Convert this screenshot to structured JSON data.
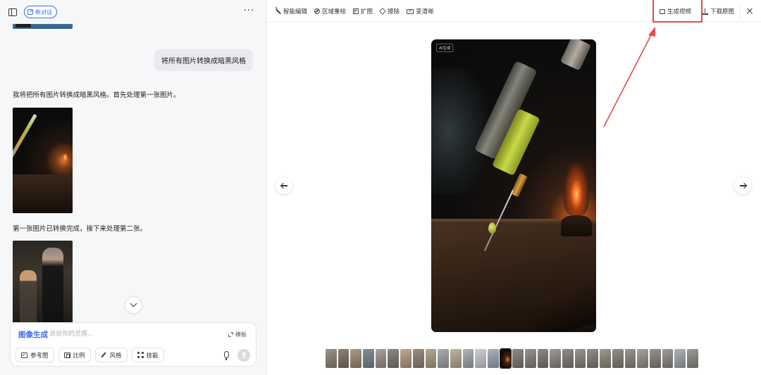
{
  "left_panel": {
    "new_chat_label": "新对话",
    "more_label": "···",
    "user_message": "将所有图片转换成暗黑风格",
    "assistant_message_1": "我将把所有图片转换成暗黑风格。首先处理第一张图片。",
    "assistant_message_2": "第一张图片已转换完成，接下来处理第二张。"
  },
  "composer": {
    "mode_label": "图像生成",
    "placeholder": "说说你的灵感...",
    "template_label": "模板",
    "tools": [
      {
        "label": "参考图",
        "icon": "image-icon"
      },
      {
        "label": "比例",
        "icon": "ratio-icon"
      },
      {
        "label": "风格",
        "icon": "brush-icon"
      },
      {
        "label": "技能",
        "icon": "grid-icon"
      }
    ],
    "mic_icon": "microphone-icon",
    "send_icon": "send-arrow-icon"
  },
  "toolbar": {
    "left_tools": [
      {
        "label": "智能编辑",
        "icon": "magic-wand-icon"
      },
      {
        "label": "区域重绘",
        "icon": "region-redraw-icon"
      },
      {
        "label": "扩图",
        "icon": "expand-image-icon"
      },
      {
        "label": "擦除",
        "icon": "eraser-icon"
      },
      {
        "label": "变清晰",
        "icon": "hd-icon"
      }
    ],
    "generate_video_label": "生成视频",
    "download_label": "下载原图",
    "close_icon": "close-icon"
  },
  "viewer": {
    "ai_badge": "AI生成",
    "prev_icon": "arrow-left-icon",
    "next_icon": "arrow-right-icon",
    "filmstrip_count": 30,
    "active_index": 15
  },
  "colors": {
    "accent": "#3b6cf6",
    "highlight": "#e84a4a"
  }
}
